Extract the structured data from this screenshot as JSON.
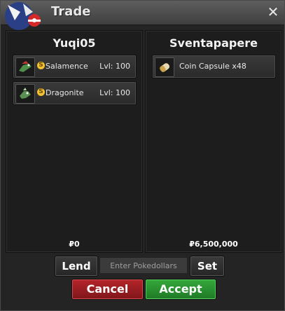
{
  "window": {
    "title": "Trade"
  },
  "left": {
    "trainer": "Yuqi05",
    "items": [
      {
        "name": "Salamence",
        "level": "Lvl: 100",
        "icon": "salamence-icon"
      },
      {
        "name": "Dragonite",
        "level": "Lvl: 100",
        "icon": "dragonite-icon"
      }
    ],
    "money": "₽0"
  },
  "right": {
    "trainer": "Sventapapere",
    "items": [
      {
        "name": "Coin Capsule x48",
        "icon": "coin-capsule-icon"
      }
    ],
    "money": "₽6,500,000"
  },
  "controls": {
    "lend": "Lend",
    "placeholder": "Enter Pokedollars",
    "set": "Set",
    "cancel": "Cancel",
    "accept": "Accept"
  },
  "coin_badge": "S",
  "colors": {
    "cancel": "#9e1e22",
    "accept": "#2a9230"
  }
}
